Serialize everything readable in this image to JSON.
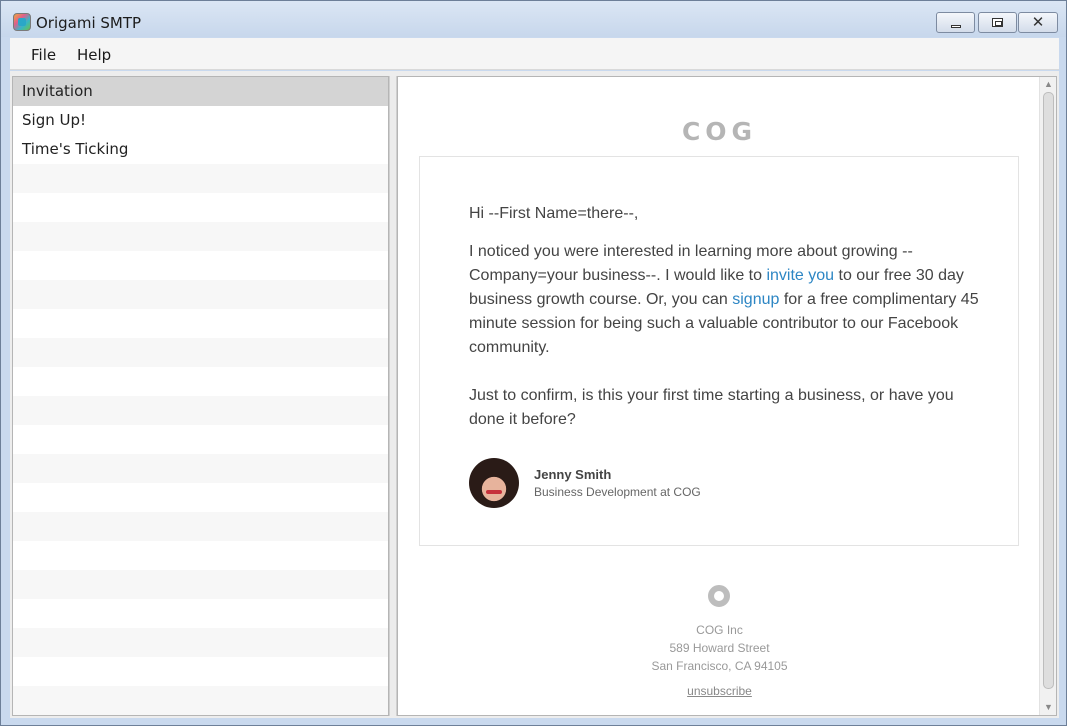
{
  "window": {
    "title": "Origami SMTP",
    "controls": {
      "minimize": "minimize",
      "maximize": "maximize",
      "close": "✕"
    }
  },
  "menu": {
    "items": [
      {
        "label": "File"
      },
      {
        "label": "Help"
      }
    ]
  },
  "templates": {
    "items": [
      {
        "label": "Invitation",
        "selected": true
      },
      {
        "label": "Sign Up!"
      },
      {
        "label": "Time's Ticking"
      }
    ]
  },
  "email": {
    "logo": "COG",
    "greeting": "Hi --First Name=there--,",
    "para1_part1": "I noticed you were interested in learning more about growing --Company=your business--. I would like to ",
    "para1_link1": "invite you",
    "para1_part2": " to our free 30 day business growth course. Or, you can ",
    "para1_link2": "signup",
    "para1_part3": " for a free complimentary 45 minute session for being such a valuable contributor to our Facebook community.",
    "para2": "Just to confirm, is this your first time starting a business, or have you done it before?",
    "signature": {
      "name": "Jenny Smith",
      "title": "Business Development at COG"
    },
    "footer": {
      "company": "COG Inc",
      "street": "589 Howard Street",
      "city": "San Francisco, CA 94105",
      "unsubscribe": "unsubscribe"
    }
  },
  "colors": {
    "link": "#2d86c4",
    "selected_row": "#d4d4d4",
    "titlebar": "#c7d7ec"
  }
}
